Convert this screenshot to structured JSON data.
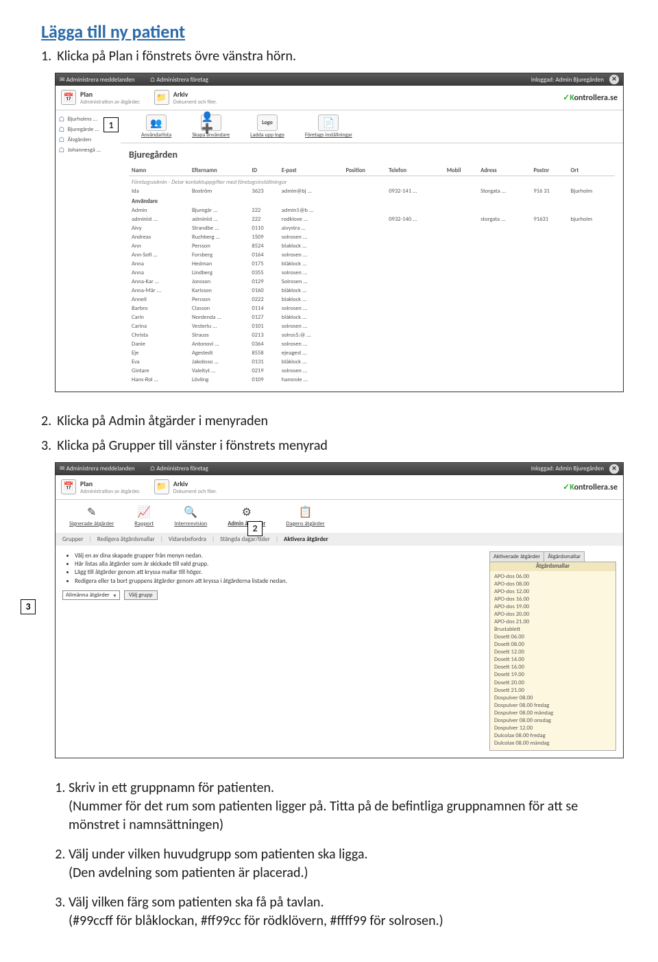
{
  "title": "Lägga till ny patient",
  "instr1": "Klicka på Plan i fönstrets övre vänstra hörn.",
  "instr2": "Klicka på Admin åtgärder i menyraden",
  "instr3": "Klicka på Grupper till vänster i fönstrets menyrad",
  "topbar": {
    "admin_msg": "Administrera meddelanden",
    "admin_co": "Administrera företag",
    "logged": "Inloggad: Admin Bjuregården"
  },
  "planbar": {
    "plan": "Plan",
    "plan_sub": "Administration av åtgärder.",
    "arkiv": "Arkiv",
    "arkiv_sub": "Dokument och filer.",
    "brand": "ontrollera.se"
  },
  "sidebar": [
    "Bjurholms ...",
    "Bjuregårde ...",
    "Älvgården",
    "Johannesgå ..."
  ],
  "tools": {
    "anvlist": "Användarlista",
    "skapa": "Skapa användare",
    "logo": "Ladda upp logo",
    "inst": "Företags inställningar"
  },
  "tableTitle": "Bjuregården",
  "cols": [
    "Namn",
    "Efternamn",
    "ID",
    "E-post",
    "Position",
    "Telefon",
    "Mobil",
    "Adress",
    "Postnr",
    "Ort"
  ],
  "subhead": "Företagsadmin - Delar kontaktuppgifter med företagsinställningar",
  "adminRow": [
    "Ida",
    "Boström",
    "3623",
    "admin@bj ...",
    "",
    "0932-141 ...",
    "",
    "Storgata ...",
    "916 31",
    "Bjurholm"
  ],
  "usersLabel": "Användare",
  "users": [
    [
      "Admin",
      "Bjuregår ...",
      "222",
      "admin1@b ...",
      "",
      "",
      "",
      "",
      "",
      ""
    ],
    [
      "administ ...",
      "administ ...",
      "222",
      "rodklove ...",
      "",
      "0932-140 ...",
      "",
      "storgata ...",
      "91631",
      "bjurholm"
    ],
    [
      "Aivy",
      "Strandbe ...",
      "0110",
      "aivystra ...",
      "",
      "",
      "",
      "",
      "",
      ""
    ],
    [
      "Andreas",
      "Ruchberg ...",
      "1509",
      "solrosen ...",
      "",
      "",
      "",
      "",
      "",
      ""
    ],
    [
      "Ann",
      "Persson",
      "8524",
      "blaklock ...",
      "",
      "",
      "",
      "",
      "",
      ""
    ],
    [
      "Ann-Sofi ...",
      "Forsberg",
      "0164",
      "solrosen ...",
      "",
      "",
      "",
      "",
      "",
      ""
    ],
    [
      "Anna",
      "Hedman",
      "0175",
      "blåklock ...",
      "",
      "",
      "",
      "",
      "",
      ""
    ],
    [
      "Anna",
      "Lindberg",
      "0355",
      "solrosen ...",
      "",
      "",
      "",
      "",
      "",
      ""
    ],
    [
      "Anna-Kar ...",
      "Jonsson",
      "0129",
      "Solrosen ...",
      "",
      "",
      "",
      "",
      "",
      ""
    ],
    [
      "Anna-Mär ...",
      "Karlsson",
      "0160",
      "blåklock ...",
      "",
      "",
      "",
      "",
      "",
      ""
    ],
    [
      "Anneli",
      "Persson",
      "0222",
      "blaklock ...",
      "",
      "",
      "",
      "",
      "",
      ""
    ],
    [
      "Barbro",
      "Classon",
      "0114",
      "solrosen ...",
      "",
      "",
      "",
      "",
      "",
      ""
    ],
    [
      "Carin",
      "Nordenda ...",
      "0127",
      "blåklock ...",
      "",
      "",
      "",
      "",
      "",
      ""
    ],
    [
      "Carina",
      "Vesterlu ...",
      "0101",
      "solrosen ...",
      "",
      "",
      "",
      "",
      "",
      ""
    ],
    [
      "Christa",
      "Strauss",
      "0213",
      "solros5:@ ...",
      "",
      "",
      "",
      "",
      "",
      ""
    ],
    [
      "Danie",
      "Antonovi ...",
      "0364",
      "solrosen ...",
      "",
      "",
      "",
      "",
      "",
      ""
    ],
    [
      "Eje",
      "Agestedt",
      "8558",
      "ejeagest ...",
      "",
      "",
      "",
      "",
      "",
      ""
    ],
    [
      "Eva",
      "Jakobsso ...",
      "0131",
      "blåklock ...",
      "",
      "",
      "",
      "",
      "",
      ""
    ],
    [
      "Gintare",
      "Valeityt ...",
      "0219",
      "solrosen ...",
      "",
      "",
      "",
      "",
      "",
      ""
    ],
    [
      "Hans-Rol ...",
      "Lövling",
      "0109",
      "hansrole ...",
      "",
      "",
      "",
      "",
      "",
      ""
    ]
  ],
  "callouts": {
    "c1": "1",
    "c2": "2",
    "c3": "3"
  },
  "ss2tools": {
    "sign": "Signerade åtgärder",
    "rap": "Rapport",
    "intern": "Internrevision",
    "admin": "Admin åtgärder",
    "dag": "Dagens åtgärder"
  },
  "ss2tabs": {
    "grupper": "Grupper",
    "mallar": "Redigera åtgärdsmallar",
    "vidare": "Vidarebefordra",
    "stangda": "Stängda dagar/tider",
    "aktivera": "Aktivera åtgärder"
  },
  "bullets": [
    "Välj en av dina skapade grupper från menyn nedan.",
    "Här listas alla åtgärder som är skickade till vald grupp.",
    "Lägg till åtgärder genom att kryssa mallar till höger.",
    "Redigera eller ta bort gruppens åtgärder genom att kryssa i åtgärderna listade nedan."
  ],
  "dropdown": "Allmänna åtgärder",
  "valj": "Välj grupp",
  "panel": {
    "tab1": "Aktiverade åtgärder",
    "tab2": "Åtgärdsmallar",
    "head": "Åtgärdsmallar",
    "items": [
      "APO-dos 06.00",
      "APO-dos 08.00",
      "APO-dos 12.00",
      "APO-dos 16.00",
      "APO-dos 19.00",
      "APO-dos 20.00",
      "APO-dos 21.00",
      "Brustablett",
      "Dosett 06.00",
      "Dosett 08.00",
      "Dosett 12.00",
      "Dosett 14.00",
      "Dosett 16.00",
      "Dosett 19.00",
      "Dosett 20.00",
      "Dosett 21.00",
      "Dospulver 08.00",
      "Dospulver 08.00 fredag",
      "Dospulver 08.00 måndag",
      "Dospulver 08.00 onsdag",
      "Dospulver 12.00",
      "Dulcolax 08.00 fredag",
      "Dulcolax 08.00 måndag"
    ]
  },
  "lower": {
    "i1a": "Skriv in ett gruppnamn för patienten.",
    "i1b": "(Nummer för det rum som patienten ligger på. Titta på de befintliga gruppnamnen för att se mönstret i namnsättningen)",
    "i2a": "Välj under vilken huvudgrupp som patienten ska ligga.",
    "i2b": "(Den avdelning som patienten är placerad.)",
    "i3a": "Välj vilken färg som patienten ska få på tavlan.",
    "i3b": "(#99ccff för blåklockan, #ff99cc för rödklövern, #ffff99 för solrosen.)"
  }
}
